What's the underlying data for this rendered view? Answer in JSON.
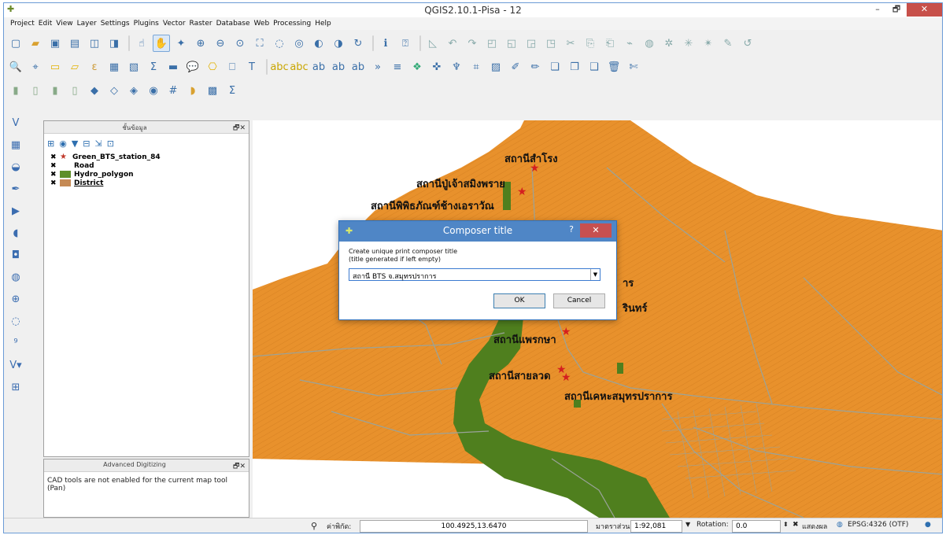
{
  "window": {
    "title": "QGIS2.10.1-Pisa - 12",
    "min": "–",
    "max": "🗗",
    "close": "✕"
  },
  "menu": [
    "Project",
    "Edit",
    "View",
    "Layer",
    "Settings",
    "Plugins",
    "Vector",
    "Raster",
    "Database",
    "Web",
    "Processing",
    "Help"
  ],
  "layers_panel": {
    "title": "ชั้นข้อมูล",
    "controls": "🗗✕",
    "layers": [
      {
        "name": "Green_BTS_station_84",
        "checked": "✖",
        "symbol": "star"
      },
      {
        "name": "Road",
        "checked": "✖",
        "symbol": "road"
      },
      {
        "name": "Hydro_polygon",
        "checked": "✖",
        "symbol": "green"
      },
      {
        "name": "District",
        "checked": "✖",
        "symbol": "brown"
      }
    ]
  },
  "advanced_panel": {
    "title": "Advanced Digitizing",
    "controls": "🗗✕",
    "message": "CAD tools are not enabled for the current map tool (Pan)"
  },
  "map": {
    "stations": [
      {
        "label": "สถานีสำโรง"
      },
      {
        "label": "สถานีปู่เจ้าสมิงพราย"
      },
      {
        "label": "สถานีพิพิธภัณฑ์ช้างเอราวัณ"
      },
      {
        "label": "าร"
      },
      {
        "label": "รินทร์"
      },
      {
        "label": "สถานีแพรกษา"
      },
      {
        "label": "สถานีสายลวด"
      },
      {
        "label": "สถานีเคหะสมุทรปราการ"
      }
    ],
    "colors": {
      "district": "#e8912c",
      "hydro": "#4f7f1e",
      "road": "#9aa39a"
    }
  },
  "dialog": {
    "title": "Composer title",
    "help": "?",
    "close": "✕",
    "instruction_line1": "Create unique print composer title",
    "instruction_line2": "(title generated if left empty)",
    "value": "สถานี BTS จ.สมุทรปราการ",
    "dropdown": "▼",
    "ok": "OK",
    "cancel": "Cancel"
  },
  "statusbar": {
    "coord_label": "ค่าพิกัด:",
    "coord_value": "100.4925,13.6470",
    "scale_label": "มาตราส่วน",
    "scale_value": "1:92,081",
    "scale_dropdown": "▼",
    "rotation_label": "Rotation:",
    "rotation_value": "0.0",
    "render_check": "✖",
    "render_label": "แสดงผล",
    "crs": "EPSG:4326 (OTF)"
  }
}
